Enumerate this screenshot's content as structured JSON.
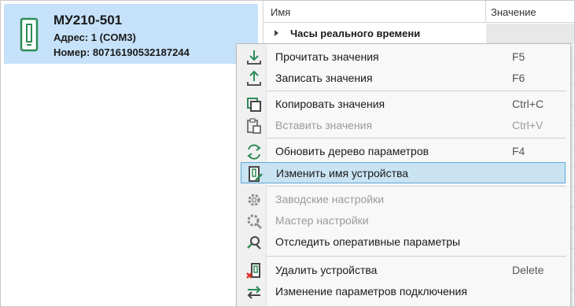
{
  "device": {
    "title": "МУ210-501",
    "address": "Адрес: 1 (COM3)",
    "number": "Номер: 80716190532187244"
  },
  "table": {
    "col_name": "Имя",
    "col_value": "Значение",
    "first_row": "Часы реального времени"
  },
  "menu": {
    "items": [
      {
        "label": "Прочитать значения",
        "key": "F5",
        "icon": "download-icon"
      },
      {
        "label": "Записать значения",
        "key": "F6",
        "icon": "upload-icon"
      },
      {
        "label": "Копировать значения",
        "key": "Ctrl+C",
        "icon": "copy-icon"
      },
      {
        "label": "Вставить значения",
        "key": "Ctrl+V",
        "icon": "paste-icon",
        "disabled": true
      },
      {
        "label": "Обновить дерево параметров",
        "key": "F4",
        "icon": "refresh-icon"
      },
      {
        "label": "Изменить имя устройства",
        "key": "",
        "icon": "rename-device-icon",
        "highlighted": true
      },
      {
        "label": "Заводские настройки",
        "key": "",
        "icon": "factory-settings-icon",
        "disabled": true
      },
      {
        "label": "Мастер настройки",
        "key": "",
        "icon": "setup-wizard-icon",
        "disabled": true
      },
      {
        "label": "Отследить оперативные параметры",
        "key": "",
        "icon": "monitor-icon"
      },
      {
        "label": "Удалить устройства",
        "key": "Delete",
        "icon": "delete-device-icon"
      },
      {
        "label": "Изменение параметров подключения",
        "key": "",
        "icon": "connection-settings-icon"
      }
    ]
  },
  "colors": {
    "selection": "#c6e2fa",
    "menu_highlight": "#c9e3f3",
    "accent_green": "#2e8b57",
    "delete_red": "#d9342b"
  }
}
